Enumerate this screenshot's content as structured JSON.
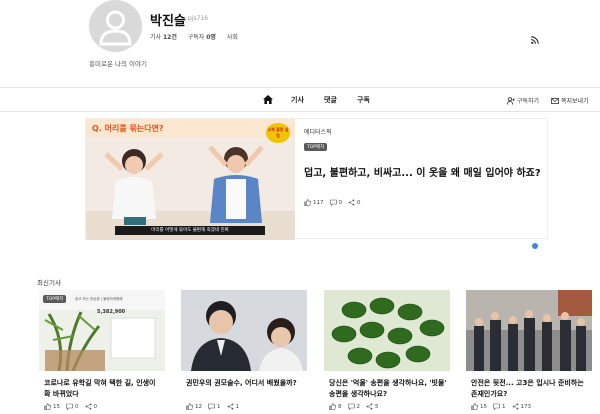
{
  "profile": {
    "name": "박진슬",
    "uid": "pjs716",
    "articles_label": "기사",
    "articles_count": "12건",
    "subscribers_label": "구독자",
    "subscribers_count": "0명",
    "section": "사회",
    "bio": "흥미로운 나의 이야기"
  },
  "nav": {
    "items": [
      "기사",
      "댓글",
      "구독"
    ],
    "subscribe": "구독하기",
    "email": "쪽지보내기"
  },
  "featured": {
    "section": "에디터스픽",
    "tag": "TOP매치",
    "title": "덥고, 불편하고, 비싸고... 이 옷을 왜 매일 입어야 하죠?",
    "image_heading": "Q. 머리를 묶는다면?",
    "image_badge": "교복 불편 실험",
    "image_caption": "머리를 어떻게 묶어도 불편해 죽겠네 진짜",
    "likes": "117",
    "comments": "0",
    "shares": "0"
  },
  "recent": {
    "title": "최신기사",
    "cards": [
      {
        "title": "코로나로 유학길 막혀 택한 길, 인생이 확 바뀌었다",
        "likes": "15",
        "comments": "0",
        "shares": "0",
        "tag": "TOP매치",
        "image_text": "광고 하는 한돈팜 | 불링하게행해",
        "image_number": "5,382,900"
      },
      {
        "title": "권민우의 권모술수, 어디서 배웠을까?",
        "likes": "12",
        "comments": "1",
        "shares": "1"
      },
      {
        "title": "당신은 '억울' 송편을 생각하나요, '빗물' 송편을 생각하나요?",
        "likes": "8",
        "comments": "2",
        "shares": "5"
      },
      {
        "title": "안전은 뒷전... 고3은 입시나 준비하는 존재인가요?",
        "likes": "15",
        "comments": "1",
        "shares": "173"
      }
    ]
  },
  "colors": {
    "accent": "#3a86e0",
    "tag_bg": "#5a5a5a"
  }
}
